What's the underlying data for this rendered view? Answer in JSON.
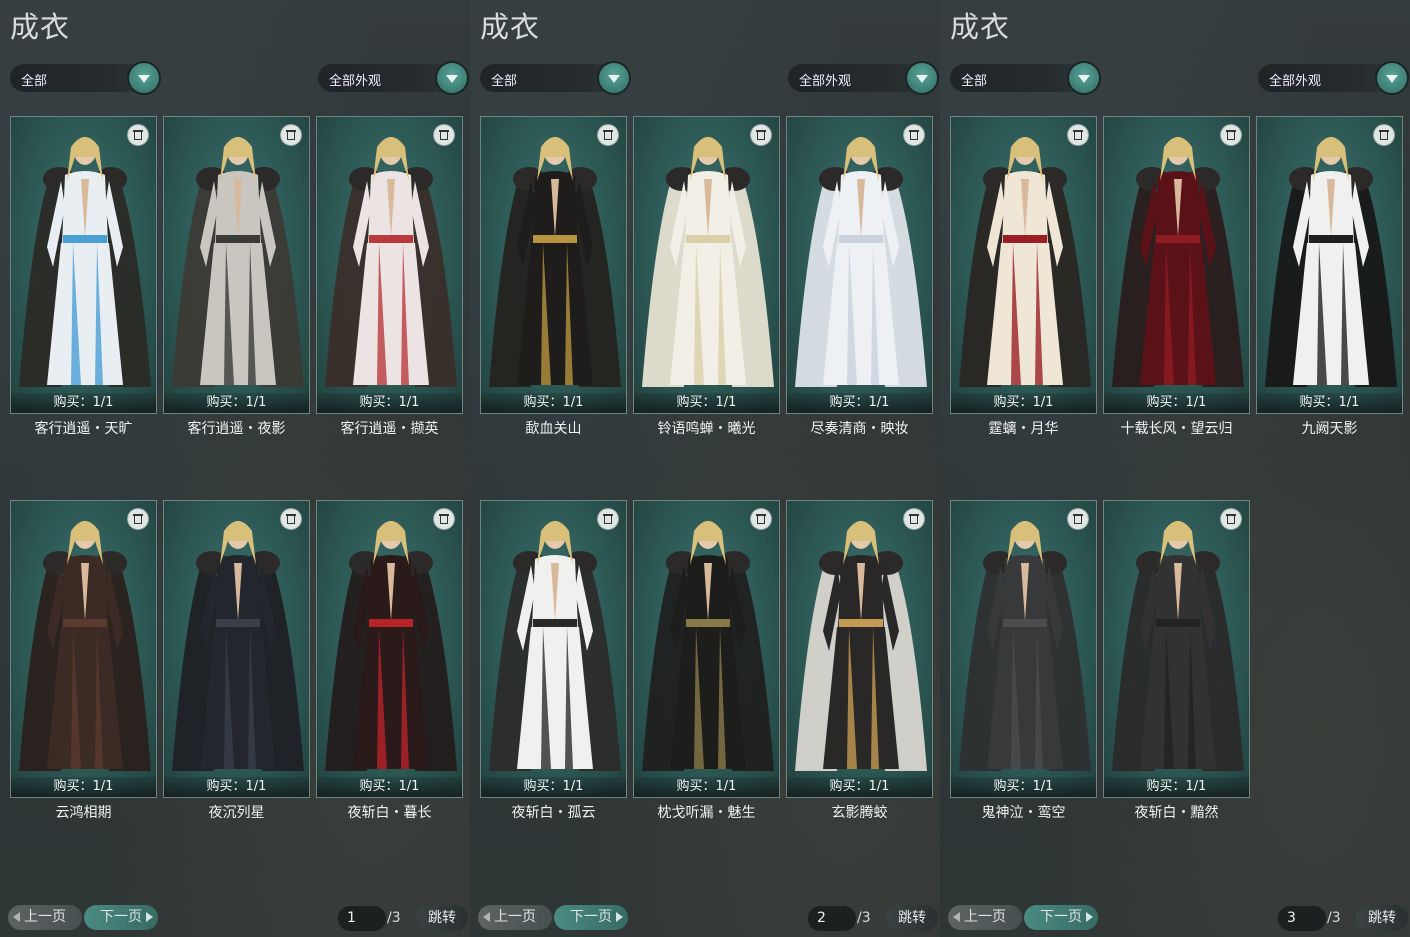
{
  "panels": [
    {
      "title": "成衣",
      "category_filter": "全部",
      "appearance_filter": "全部外观",
      "items": [
        {
          "name": "客行逍遥・天旷",
          "buy": "购买：1/1",
          "robe": "#e8eef2",
          "accent": "#4a9fd6",
          "cloak": "#2a2a26"
        },
        {
          "name": "客行逍遥・夜影",
          "buy": "购买：1/1",
          "robe": "#c9c6c0",
          "accent": "#3a3a38",
          "cloak": "#3c3a35"
        },
        {
          "name": "客行逍遥・撷英",
          "buy": "购买：1/1",
          "robe": "#ece4e2",
          "accent": "#b8393e",
          "cloak": "#3a2e2a"
        },
        {
          "name": "云鸿相期",
          "buy": "购买：1/1",
          "robe": "#3c2a24",
          "accent": "#5a3a2e",
          "cloak": "#2a201c"
        },
        {
          "name": "夜沉列星",
          "buy": "购买：1/1",
          "robe": "#23262c",
          "accent": "#3a3f4a",
          "cloak": "#1f2024"
        },
        {
          "name": "夜斩白・暮长",
          "buy": "购买：1/1",
          "robe": "#2a1a1a",
          "accent": "#b8232a",
          "cloak": "#241c1c"
        }
      ],
      "pager": {
        "prev": "上一页",
        "next": "下一页",
        "current": "1",
        "total": "/3",
        "jump": "跳转"
      }
    },
    {
      "title": "成衣",
      "category_filter": "全部",
      "appearance_filter": "全部外观",
      "items": [
        {
          "name": "歃血关山",
          "buy": "购买：1/1",
          "robe": "#1e1d1b",
          "accent": "#b89340",
          "cloak": "#24221f"
        },
        {
          "name": "铃语鸣蝉・曦光",
          "buy": "购买：1/1",
          "robe": "#f1efe6",
          "accent": "#d9cfa8",
          "cloak": "#e6e2d2"
        },
        {
          "name": "尽奏清商・映妆",
          "buy": "购买：1/1",
          "robe": "#eef1f4",
          "accent": "#c9d2dc",
          "cloak": "#dde3e8"
        },
        {
          "name": "夜斩白・孤云",
          "buy": "购买：1/1",
          "robe": "#f0f0ee",
          "accent": "#2a2a2a",
          "cloak": "#2c2c2c"
        },
        {
          "name": "枕戈听漏・魅生",
          "buy": "购买：1/1",
          "robe": "#1d1d1c",
          "accent": "#8a7a4a",
          "cloak": "#202020"
        },
        {
          "name": "玄影腾蛟",
          "buy": "购买：1/1",
          "robe": "#2a2826",
          "accent": "#c49a52",
          "cloak": "#d9d5cf"
        }
      ],
      "pager": {
        "prev": "上一页",
        "next": "下一页",
        "current": "2",
        "total": "/3",
        "jump": "跳转"
      }
    },
    {
      "title": "成衣",
      "category_filter": "全部",
      "appearance_filter": "全部外观",
      "items": [
        {
          "name": "霆螭・月华",
          "buy": "购买：1/1",
          "robe": "#efe6d6",
          "accent": "#9a1f24",
          "cloak": "#2a2622"
        },
        {
          "name": "十载长风・望云归",
          "buy": "购买：1/1",
          "robe": "#5a1218",
          "accent": "#8e1b22",
          "cloak": "#2a1c1c"
        },
        {
          "name": "九阙天影",
          "buy": "购买：1/1",
          "robe": "#f0f0ee",
          "accent": "#1f1f1f",
          "cloak": "#181818"
        },
        {
          "name": "鬼神泣・鸾空",
          "buy": "购买：1/1",
          "robe": "#38393a",
          "accent": "#4a4c4e",
          "cloak": "#2e2f30"
        },
        {
          "name": "夜斩白・黯然",
          "buy": "购买：1/1",
          "robe": "#323232",
          "accent": "#222222",
          "cloak": "#2a2a2a"
        }
      ],
      "pager": {
        "prev": "上一页",
        "next": "下一页",
        "current": "3",
        "total": "/3",
        "jump": "跳转"
      }
    }
  ]
}
